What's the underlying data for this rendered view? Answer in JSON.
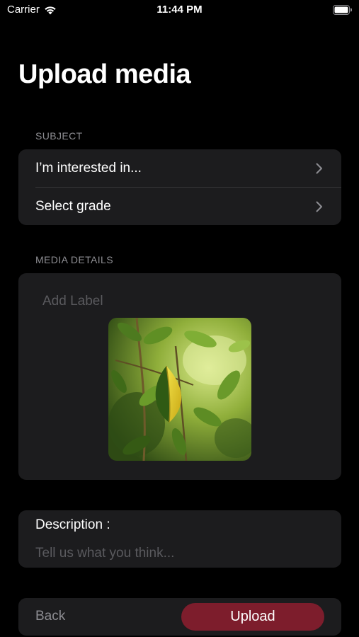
{
  "status_bar": {
    "carrier": "Carrier",
    "time": "11:44 PM"
  },
  "page": {
    "title": "Upload media"
  },
  "subject": {
    "header": "SUBJECT",
    "interest_label": "I’m interested in...",
    "grade_label": "Select grade"
  },
  "media_details": {
    "header": "MEDIA DETAILS",
    "label_placeholder": "Add Label"
  },
  "description": {
    "label": "Description :",
    "placeholder": "Tell us what you think..."
  },
  "actions": {
    "back_label": "Back",
    "upload_label": "Upload"
  },
  "colors": {
    "background": "#000000",
    "card": "#1c1c1e",
    "accent_upload": "#7d1d2c",
    "secondary_text": "#8e8e93",
    "placeholder_text": "#5a5a5e"
  }
}
